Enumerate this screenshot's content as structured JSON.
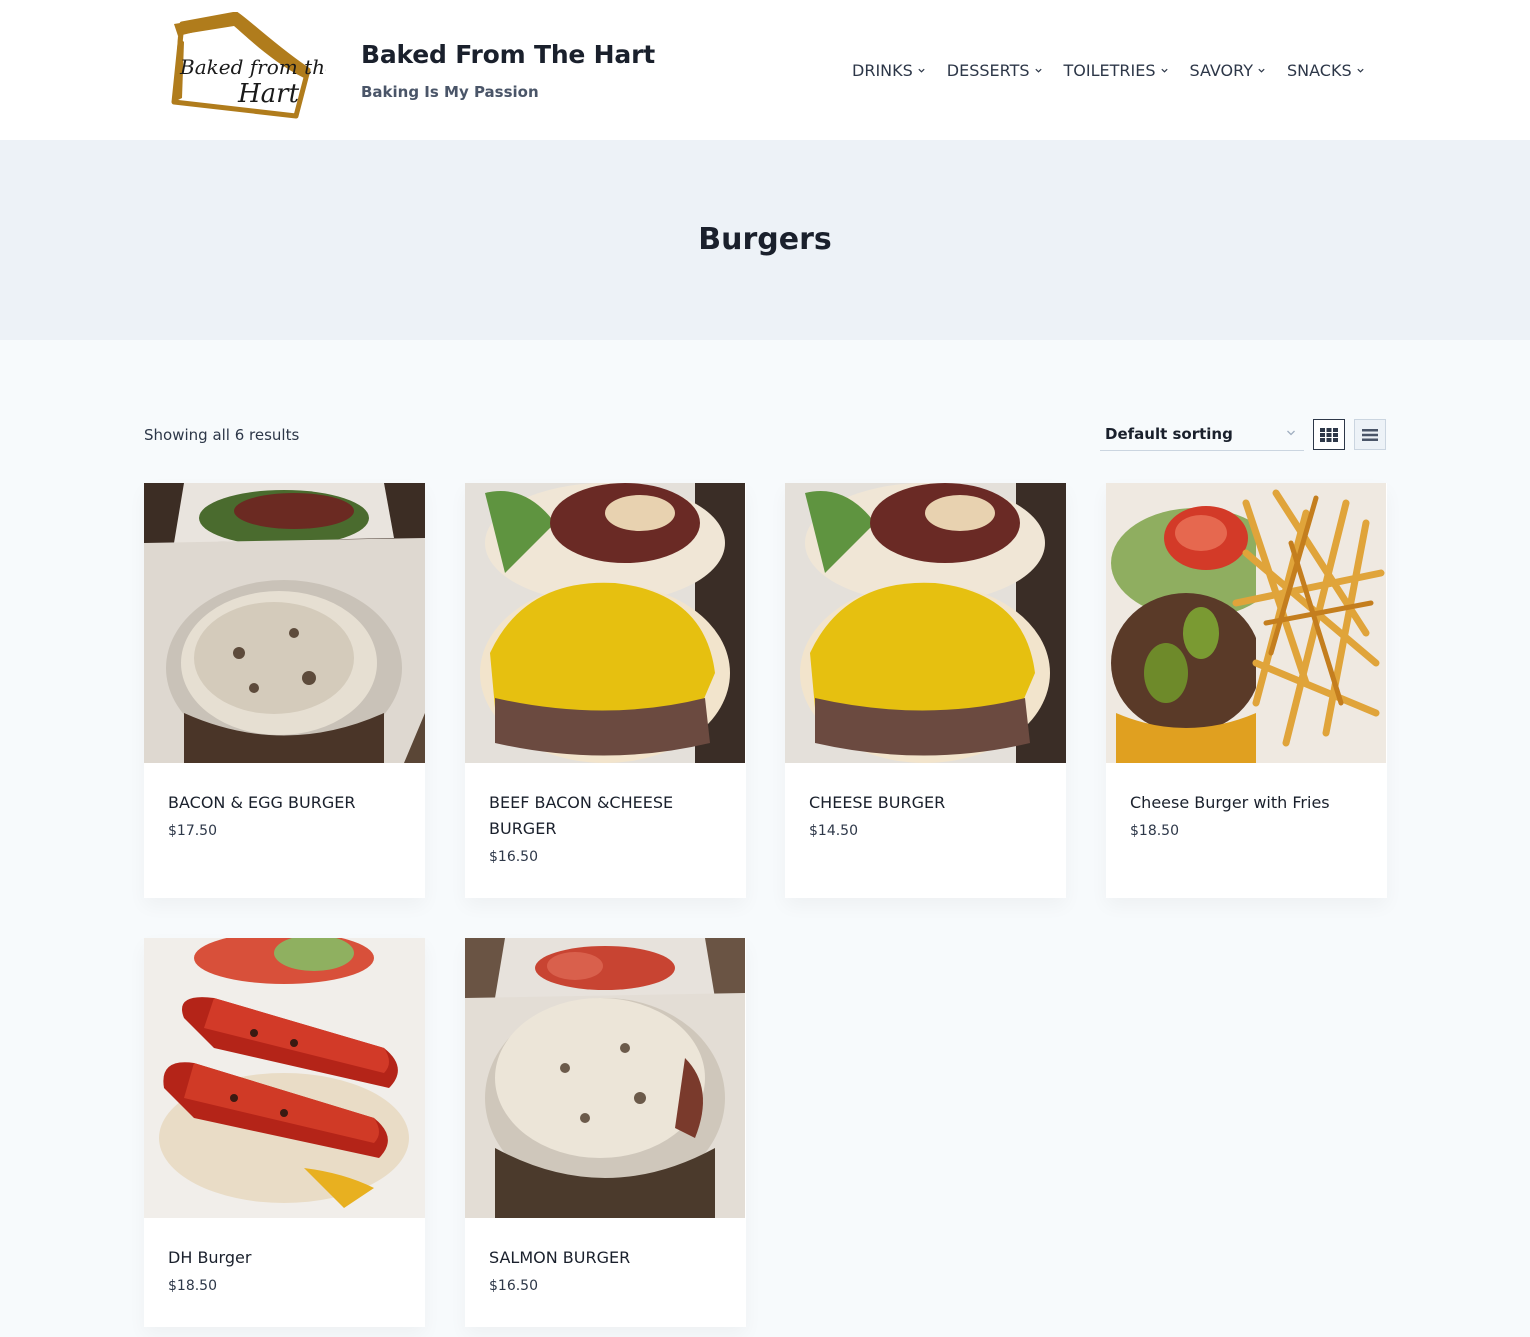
{
  "brand": {
    "logo_text": "Baked from the Hart",
    "title": "Baked From The Hart",
    "tagline": "Baking Is My Passion"
  },
  "nav": {
    "items": [
      {
        "label": "DRINKS"
      },
      {
        "label": "DESSERTS"
      },
      {
        "label": "TOILETRIES"
      },
      {
        "label": "SAVORY"
      },
      {
        "label": "SNACKS"
      }
    ]
  },
  "page": {
    "title": "Burgers"
  },
  "toolbar": {
    "result_count": "Showing all 6 results",
    "sort_selected": "Default sorting"
  },
  "products": [
    {
      "name": "BACON & EGG BURGER",
      "price": "$17.50"
    },
    {
      "name": "BEEF BACON &CHEESE BURGER",
      "price": "$16.50"
    },
    {
      "name": "CHEESE BURGER",
      "price": "$14.50"
    },
    {
      "name": "Cheese Burger with Fries",
      "price": "$18.50"
    },
    {
      "name": "DH Burger",
      "price": "$18.50"
    },
    {
      "name": "SALMON BURGER",
      "price": "$16.50"
    }
  ],
  "colors": {
    "logo_gold": "#b07c1c",
    "header_bg": "#ffffff",
    "title_band_bg": "#edf2f7",
    "page_bg": "#f7fafc"
  }
}
